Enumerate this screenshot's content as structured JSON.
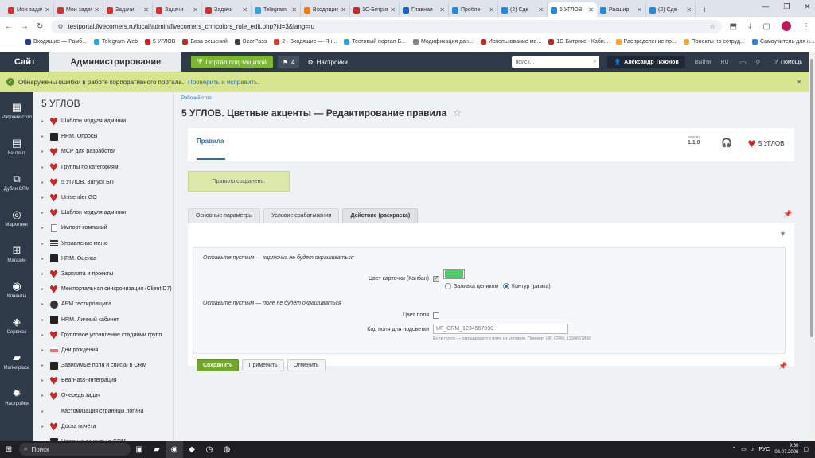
{
  "browser": {
    "tabs": [
      {
        "label": "Мои задачи",
        "fav": "#d32f2f"
      },
      {
        "label": "Мои задачи",
        "fav": "#d32f2f"
      },
      {
        "label": "Задачи",
        "fav": "#d32f2f"
      },
      {
        "label": "Задачи",
        "fav": "#d32f2f"
      },
      {
        "label": "Задачи",
        "fav": "#d32f2f"
      },
      {
        "label": "Telegram",
        "fav": "#2aa3df"
      },
      {
        "label": "Входящие",
        "fav": "#f57c00"
      },
      {
        "label": "1С-Битрикс",
        "fav": "#c62828"
      },
      {
        "label": "Главная",
        "fav": "#1565c0"
      },
      {
        "label": "Пробле",
        "fav": "#1e88e5"
      },
      {
        "label": "(2) Сде",
        "fav": "#1e88e5"
      },
      {
        "label": "5 УГЛОВ",
        "fav": "#1e88e5"
      },
      {
        "label": "Расшир",
        "fav": "#1e88e5"
      },
      {
        "label": "(2) Сде",
        "fav": "#1e88e5"
      }
    ],
    "url": "testportal.fivecorners.ru/local/admin/fivecorners_crmcolors_rule_edit.php?id=3&lang=ru",
    "bookmarks": [
      {
        "label": "Входящие — Рамб...",
        "fav": "#1e40a0"
      },
      {
        "label": "Telegram Web",
        "fav": "#2aa3df"
      },
      {
        "label": "5 УГЛОВ",
        "fav": "#c62828"
      },
      {
        "label": "База решений",
        "fav": "#c62828"
      },
      {
        "label": "BearPass",
        "fav": "#444"
      },
      {
        "label": "2 · Входящие — Ян...",
        "fav": "#e53935"
      },
      {
        "label": "Тестовый портал Б...",
        "fav": "#2aa3df"
      },
      {
        "label": "Модификация дан...",
        "fav": "#888"
      },
      {
        "label": "Использование ме...",
        "fav": "#c62828"
      },
      {
        "label": "1С-Битрикс - Каби...",
        "fav": "#c62828"
      },
      {
        "label": "Распределение пр...",
        "fav": "#f9a825"
      },
      {
        "label": "Проекты по сотруд...",
        "fav": "#f9a825"
      },
      {
        "label": "Самоучитель для н...",
        "fav": "#1e88e5"
      }
    ]
  },
  "header": {
    "site": "Сайт",
    "admin": "Администрирование",
    "portal": "Портал под защитой",
    "notifications": "4",
    "settings": "Настройки",
    "search_placeholder": "поиск...",
    "user": "Александр Тихонов",
    "logout": "Выйти",
    "lang": "RU",
    "help": "Помощь"
  },
  "warning": {
    "text": "Обнаружены ошибки в работе корпоративного портала.",
    "link": "Проверить и исправить."
  },
  "iconbar": [
    {
      "label": "Рабочий стол",
      "icon": "home-icon",
      "glyph": "▦"
    },
    {
      "label": "Контент",
      "icon": "content-icon",
      "glyph": "▤"
    },
    {
      "label": "Дубли CRM",
      "icon": "crm-icon",
      "glyph": "⧉"
    },
    {
      "label": "Маркетинг",
      "icon": "marketing-icon",
      "glyph": "◎"
    },
    {
      "label": "Магазин",
      "icon": "shop-icon",
      "glyph": "⊞"
    },
    {
      "label": "Клиенты",
      "icon": "clients-icon",
      "glyph": "◉"
    },
    {
      "label": "Сервисы",
      "icon": "services-icon",
      "glyph": "◈"
    },
    {
      "label": "Marketplace",
      "icon": "marketplace-icon",
      "glyph": "▰"
    },
    {
      "label": "Настройки",
      "icon": "settings-icon",
      "glyph": "✹"
    }
  ],
  "tree": {
    "title": "5 УГЛОВ",
    "items": [
      {
        "label": "Шаблон модуля админки",
        "ic": "star"
      },
      {
        "label": "HRM. Опросы",
        "ic": "sq"
      },
      {
        "label": "МСР для разработки",
        "ic": "star"
      },
      {
        "label": "Группы по категориям",
        "ic": "star"
      },
      {
        "label": "5 УГЛОВ. Запуск БП",
        "ic": "star"
      },
      {
        "label": "Unisender GO",
        "ic": "star"
      },
      {
        "label": "Шаблон модуля админки",
        "ic": "star"
      },
      {
        "label": "Импорт компаний",
        "ic": "doc"
      },
      {
        "label": "Управление меню",
        "ic": "lines"
      },
      {
        "label": "HRM. Оценка",
        "ic": "sq"
      },
      {
        "label": "Зарплата и проекты",
        "ic": "star"
      },
      {
        "label": "Межпортальная синхронизация (Client D7)",
        "ic": "star"
      },
      {
        "label": "АРМ тестировщика",
        "ic": "gear"
      },
      {
        "label": "HRM. Личный кабинет",
        "ic": "sq"
      },
      {
        "label": "Групповое управление стадиями групп",
        "ic": "star"
      },
      {
        "label": "Дни рождения",
        "ic": "cake"
      },
      {
        "label": "Зависимые поля и списки в CRM",
        "ic": "sq"
      },
      {
        "label": "BearPass-интеграция",
        "ic": "star"
      },
      {
        "label": "Очередь задач",
        "ic": "star"
      },
      {
        "label": "Кастомизация страницы логина",
        "ic": "none"
      },
      {
        "label": "Доска почёта",
        "ic": "star"
      },
      {
        "label": "Цветные акценты в CRM",
        "ic": "sq"
      }
    ]
  },
  "main": {
    "breadcrumb": "Рабочий стол",
    "title": "5 УГЛОВ. Цветные акценты — Редактирование правила",
    "card_tab": "Правила",
    "version_label": "версия",
    "version": "1.1.0",
    "brand": "5 УГЛОВ",
    "saved_message": "Правило сохранено.",
    "tabs": [
      "Основные параметры",
      "Условие срабатывания",
      "Действие (раскраска)"
    ],
    "active_tab": 2,
    "form": {
      "hint_card": "Оставьте пустым — карточка не будет окрашиваться",
      "card_color_label": "Цвет карточки (Канбан)",
      "card_color_value": "#4ccd6a",
      "fill_label": "Заливка целиком",
      "outline_label": "Контур (рамка)",
      "hint_field": "Оставьте пустым — поле не будет окрашиваться",
      "field_color_label": "Цвет поля",
      "field_code_label": "Код поля для подсветки",
      "field_code_placeholder": "UF_CRM_1234567890",
      "field_code_hint": "Если пусто — окрашивается поле из условия. Пример: UF_CRM_1234567890"
    },
    "buttons": {
      "save": "Сохранить",
      "apply": "Применить",
      "cancel": "Отменить"
    }
  },
  "taskbar": {
    "search": "Поиск",
    "lang": "РУС",
    "time": "9:30",
    "date": "08.07.2026"
  }
}
